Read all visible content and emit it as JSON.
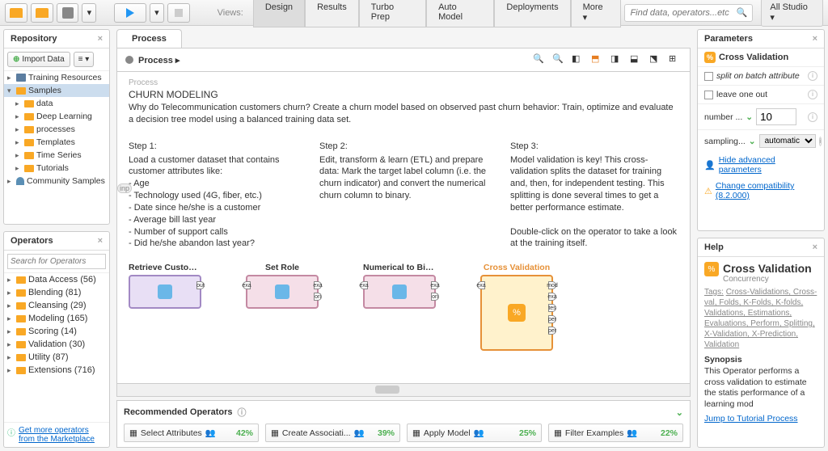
{
  "toolbar": {
    "views_label": "Views:",
    "tabs": [
      "Design",
      "Results",
      "Turbo Prep",
      "Auto Model",
      "Deployments",
      "More ▾"
    ],
    "search_placeholder": "Find data, operators...etc",
    "studio_dropdown": "All Studio ▾"
  },
  "repository": {
    "title": "Repository",
    "import_btn": "Import Data",
    "tree": [
      {
        "label": "Training Resources",
        "icon": "book",
        "indent": 0,
        "toggle": "▸"
      },
      {
        "label": "Samples",
        "icon": "folder",
        "indent": 0,
        "toggle": "▾",
        "selected": true
      },
      {
        "label": "data",
        "icon": "folder",
        "indent": 1,
        "toggle": "▸"
      },
      {
        "label": "Deep Learning",
        "icon": "folder",
        "indent": 1,
        "toggle": "▸"
      },
      {
        "label": "processes",
        "icon": "folder",
        "indent": 1,
        "toggle": "▸"
      },
      {
        "label": "Templates",
        "icon": "folder",
        "indent": 1,
        "toggle": "▸"
      },
      {
        "label": "Time Series",
        "icon": "folder",
        "indent": 1,
        "toggle": "▸"
      },
      {
        "label": "Tutorials",
        "icon": "folder",
        "indent": 1,
        "toggle": "▸"
      },
      {
        "label": "Community Samples",
        "icon": "person",
        "indent": 0,
        "toggle": "▸"
      }
    ]
  },
  "operators": {
    "title": "Operators",
    "search_placeholder": "Search for Operators",
    "items": [
      {
        "label": "Data Access (56)"
      },
      {
        "label": "Blending (81)"
      },
      {
        "label": "Cleansing (29)"
      },
      {
        "label": "Modeling (165)"
      },
      {
        "label": "Scoring (14)"
      },
      {
        "label": "Validation (30)"
      },
      {
        "label": "Utility (87)"
      },
      {
        "label": "Extensions (716)"
      }
    ],
    "more_link": "Get more operators from the Marketplace"
  },
  "process": {
    "tab": "Process",
    "breadcrumb": "Process ▸",
    "section_label": "Process",
    "title": "CHURN MODELING",
    "subtitle": "Why do Telecommunication customers churn? Create a churn model based on observed past churn behavior: Train, optimize and evaluate a decision tree model using a balanced training data set.",
    "inp": "inp",
    "steps": [
      {
        "h": "Step 1:",
        "body": "Load a customer dataset that contains customer attributes like:\n- Age\n- Technology used (4G, fiber, etc.)\n- Date since he/she is a customer\n- Average bill last year\n- Number of support calls\n- Did he/she abandon last year?"
      },
      {
        "h": "Step 2:",
        "body": "Edit, transform & learn (ETL) and prepare data: Mark the target label column (i.e. the churn indicator) and convert the numerical churn column to binary."
      },
      {
        "h": "Step 3:",
        "body": "Model validation is key! This cross-validation splits the dataset for training and, then, for independent testing. This splitting is done several times to get a better performance estimate.\n\nDouble-click on the operator to take a look at the training itself."
      }
    ],
    "ops": [
      {
        "label": "Retrieve Customer ...",
        "type": "purple",
        "ports_r": [
          "out"
        ]
      },
      {
        "label": "Set Role",
        "type": "pink",
        "ports_l": [
          "exa"
        ],
        "ports_r": [
          "exa",
          "ori"
        ]
      },
      {
        "label": "Numerical to Binom...",
        "type": "pink",
        "ports_l": [
          "exa"
        ],
        "ports_r": [
          "exa",
          "ori"
        ]
      },
      {
        "label": "Cross Validation",
        "type": "orange",
        "ports_l": [
          "exa"
        ],
        "ports_r": [
          "mod",
          "exa",
          "tes",
          "per",
          "per"
        ]
      }
    ]
  },
  "recommended": {
    "title": "Recommended Operators",
    "items": [
      {
        "label": "Select Attributes",
        "pct": "42%"
      },
      {
        "label": "Create Associati...",
        "pct": "39%"
      },
      {
        "label": "Apply Model",
        "pct": "25%"
      },
      {
        "label": "Filter Examples",
        "pct": "22%"
      }
    ]
  },
  "parameters": {
    "title": "Parameters",
    "op_name": "Cross Validation",
    "rows": {
      "split_attr": "split on batch attribute",
      "leave_one": "leave one out",
      "number_label": "number ...",
      "number_value": "10",
      "sampling_label": "sampling...",
      "sampling_value": "automatic"
    },
    "adv_link": "Hide advanced parameters",
    "compat_link": "Change compatibility (8.2.000)"
  },
  "help": {
    "title": "Help",
    "op": "Cross Validation",
    "sub": "Concurrency",
    "tags_label": "Tags:",
    "tags": "Cross-Validations, Cross-val, Folds, K-Folds, K-folds, Validations, Estimations, Evaluations, Perform, Splitting, X-Validation, X-Prediction, Validation",
    "synopsis_h": "Synopsis",
    "synopsis": "This Operator performs a cross validation to estimate the statis performance of a learning mod",
    "jump_link": "Jump to Tutorial Process"
  }
}
